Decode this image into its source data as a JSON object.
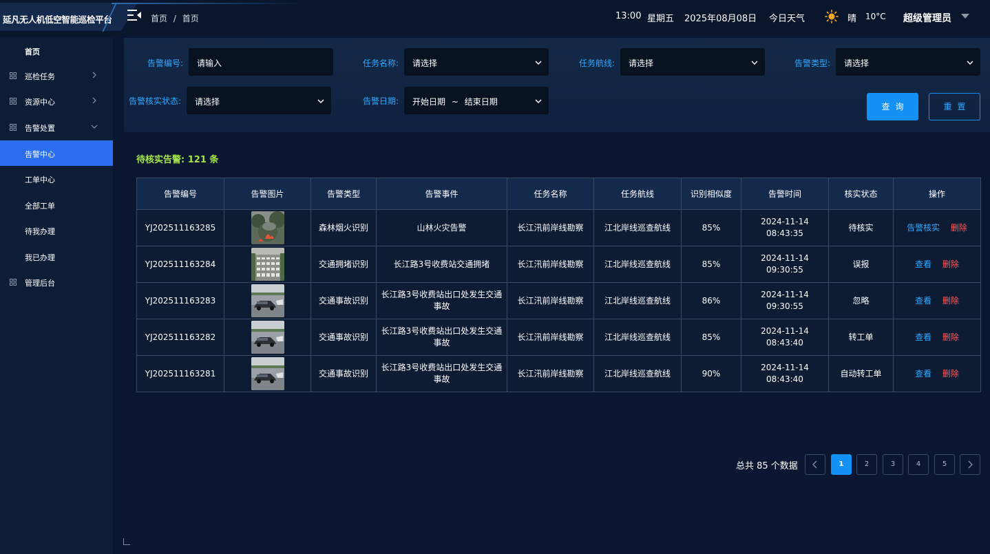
{
  "app": {
    "title": "延凡无人机低空智能巡检平台"
  },
  "breadcrumb": {
    "item1": "首页",
    "separator": "/",
    "item2": "首页"
  },
  "header": {
    "time": "13:00",
    "weekday": "星期五",
    "date": "2025年08月08日",
    "weather_label": "今日天气",
    "weather_icon": "sun-icon",
    "weather_status": "晴",
    "temperature": "10°C",
    "user": "超级管理员"
  },
  "sidebar": {
    "items": [
      {
        "label": "首页"
      },
      {
        "label": "巡检任务"
      },
      {
        "label": "资源中心"
      },
      {
        "label": "告警处置"
      },
      {
        "label": "告警中心"
      },
      {
        "label": "工单中心"
      },
      {
        "label": "全部工单"
      },
      {
        "label": "待我办理"
      },
      {
        "label": "我已办理"
      },
      {
        "label": "管理后台"
      }
    ],
    "active_color": "#2b6ff0"
  },
  "filters": {
    "alarm_no": {
      "label": "告警编号:",
      "placeholder": "请输入"
    },
    "task_name": {
      "label": "任务名称:",
      "value": "请选择"
    },
    "task_route": {
      "label": "任务航线:",
      "value": "请选择"
    },
    "alarm_type": {
      "label": "告警类型:",
      "value": "请选择"
    },
    "verify_status": {
      "label": "告警核实状态:",
      "value": "请选择"
    },
    "alarm_date": {
      "label": "告警日期:",
      "start": "开始日期",
      "sep": "~",
      "end": "结束日期"
    },
    "query_label": "查询",
    "reset_label": "重置"
  },
  "summary": {
    "pending_label": "待核实告警:",
    "pending_count": "121 条"
  },
  "table": {
    "headers": [
      "告警编号",
      "告警图片",
      "告警类型",
      "告警事件",
      "任务名称",
      "任务航线",
      "识别相似度",
      "告警时间",
      "核实状态",
      "操作"
    ],
    "rows": [
      {
        "id": "YJ202511163285",
        "image": "forest-fire-photo",
        "type": "森林烟火识别",
        "event": "山林火灾告警",
        "task": "长江汛前岸线勘察",
        "route": "江北岸线巡查航线",
        "similarity": "85%",
        "time": "2024-11-14 08:43:35",
        "status": "待核实",
        "op1": "告警核实",
        "op2": "删除"
      },
      {
        "id": "YJ202511163284",
        "image": "traffic-jam-photo",
        "type": "交通拥堵识别",
        "event": "长江路3号收费站交通拥堵",
        "task": "长江汛前岸线勘察",
        "route": "江北岸线巡查航线",
        "similarity": "85%",
        "time": "2024-11-14 09:30:55",
        "status": "误报",
        "op1": "查看",
        "op2": "删除"
      },
      {
        "id": "YJ202511163283",
        "image": "traffic-accident-photo",
        "type": "交通事故识别",
        "event": "长江路3号收费站出口处发生交通事故",
        "task": "长江汛前岸线勘察",
        "route": "江北岸线巡查航线",
        "similarity": "86%",
        "time": "2024-11-14 09:30:55",
        "status": "忽略",
        "op1": "查看",
        "op2": "删除"
      },
      {
        "id": "YJ202511163282",
        "image": "traffic-accident-photo",
        "type": "交通事故识别",
        "event": "长江路3号收费站出口处发生交通事故",
        "task": "长江汛前岸线勘察",
        "route": "江北岸线巡查航线",
        "similarity": "85%",
        "time": "2024-11-14 08:43:40",
        "status": "转工单",
        "op1": "查看",
        "op2": "删除"
      },
      {
        "id": "YJ202511163281",
        "image": "traffic-accident-photo",
        "type": "交通事故识别",
        "event": "长江路3号收费站出口处发生交通事故",
        "task": "长江汛前岸线勘察",
        "route": "江北岸线巡查航线",
        "similarity": "90%",
        "time": "2024-11-14 08:43:40",
        "status": "自动转工单",
        "op1": "查看",
        "op2": "删除"
      }
    ]
  },
  "pagination": {
    "total_text": "总共 85 个数据",
    "pages": [
      "1",
      "2",
      "3",
      "4",
      "5"
    ],
    "current": "1"
  }
}
